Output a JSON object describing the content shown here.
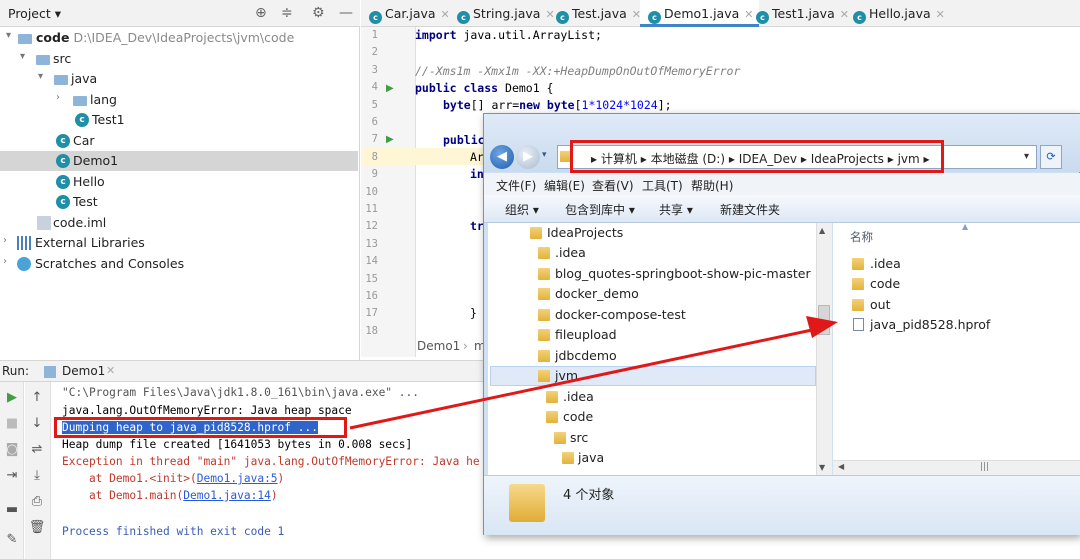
{
  "project_panel": {
    "title": "Project",
    "tree": [
      {
        "label": "code",
        "path": "D:\\IDEA_Dev\\IdeaProjects\\jvm\\code"
      },
      {
        "label": "src"
      },
      {
        "label": "java"
      },
      {
        "label": "lang"
      },
      {
        "label": "Test1"
      },
      {
        "label": "Car"
      },
      {
        "label": "Demo1"
      },
      {
        "label": "Hello"
      },
      {
        "label": "Test"
      },
      {
        "label": "code.iml"
      },
      {
        "label": "External Libraries"
      },
      {
        "label": "Scratches and Consoles"
      }
    ]
  },
  "editor_tabs": [
    "Car.java",
    "String.java",
    "Test.java",
    "Demo1.java",
    "Test1.java",
    "Hello.java"
  ],
  "editor": {
    "line_numbers": [
      "1",
      "2",
      "3",
      "4",
      "5",
      "6",
      "7",
      "8",
      "9",
      "10",
      "11",
      "12",
      "13",
      "14",
      "15",
      "16",
      "17",
      "18"
    ],
    "line1": "import java.util.ArrayList;",
    "line3": "//-Xms1m -Xmx1m -XX:+HeapDumpOnOutOfMemoryError",
    "line4_kw": "public class",
    "line4_rest": " Demo1 {",
    "line5_kw": "byte",
    "line5_a": "[] arr=",
    "line5_new": "new",
    "line5_b": " ",
    "line5_kw2": "byte",
    "line5_c": "[",
    "line5_num": "1*1024*1024",
    "line5_d": "];",
    "line7": "public",
    "line8": "Ar",
    "line9": "in",
    "line12": "tr",
    "line17": "}",
    "breadcrumb": "Demo1",
    "breadcrumb_sep": "›",
    "breadcrumb_tail": "m"
  },
  "run_panel": {
    "label": "Run:",
    "tab": "Demo1",
    "lines": {
      "cmd": "\"C:\\Program Files\\Java\\jdk1.8.0_161\\bin\\java.exe\" ...",
      "oom": "java.lang.OutOfMemoryError: Java heap space",
      "dump": "Dumping heap to java_pid8528.hprof ...",
      "created": "Heap dump file created [1641053 bytes in 0.008 secs]",
      "exception": "Exception in thread \"main\" java.lang.OutOfMemoryError: Java he",
      "at1_pre": "    at Demo1.<init>(",
      "at1_link": "Demo1.java:5",
      "at1_post": ")",
      "at2_pre": "    at Demo1.main(",
      "at2_link": "Demo1.java:14",
      "at2_post": ")",
      "finished": "Process finished with exit code 1"
    }
  },
  "explorer": {
    "address": [
      "计算机",
      "本地磁盘 (D:)",
      "IDEA_Dev",
      "IdeaProjects",
      "jvm"
    ],
    "menu": [
      "文件(F)",
      "编辑(E)",
      "查看(V)",
      "工具(T)",
      "帮助(H)"
    ],
    "commands": [
      "组织 ▾",
      "包含到库中 ▾",
      "共享 ▾",
      "新建文件夹"
    ],
    "nav_tree": [
      "IdeaProjects",
      ".idea",
      "blog_quotes-springboot-show-pic-master",
      "docker_demo",
      "docker-compose-test",
      "fileupload",
      "jdbcdemo",
      "jvm",
      ".idea",
      "code",
      "src",
      "java"
    ],
    "column_name": "名称",
    "files": [
      ".idea",
      "code",
      "out",
      "java_pid8528.hprof"
    ],
    "status": "4 个对象"
  }
}
